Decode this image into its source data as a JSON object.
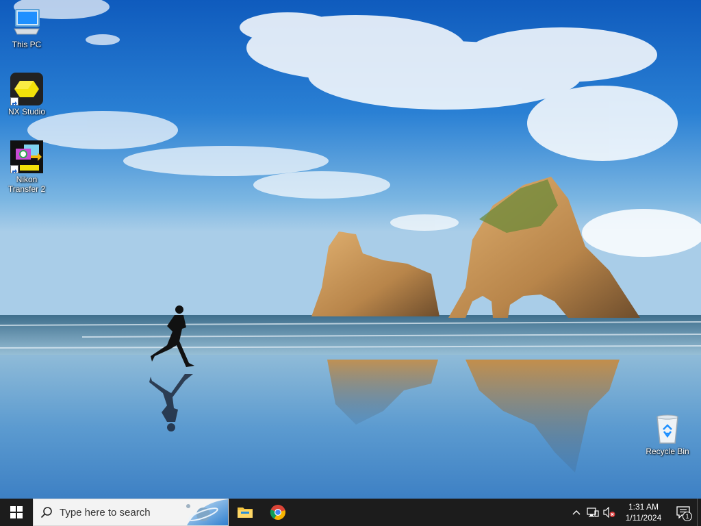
{
  "desktop": {
    "icons": [
      {
        "label": "This PC",
        "icon": "computer-icon"
      },
      {
        "label": "NX Studio",
        "icon": "nx-studio-icon"
      },
      {
        "label": "Nikon Transfer 2",
        "icon": "nikon-transfer-icon"
      },
      {
        "label": "Recycle Bin",
        "icon": "recycle-bin-icon"
      }
    ]
  },
  "taskbar": {
    "search": {
      "placeholder": "Type here to search"
    },
    "pinned": [
      {
        "name": "File Explorer",
        "icon": "folder-icon"
      },
      {
        "name": "Google Chrome",
        "icon": "chrome-icon"
      }
    ],
    "tray": {
      "time": "1:31 AM",
      "date": "1/11/2024",
      "notification_count": "1"
    }
  },
  "colors": {
    "taskbar_bg": "#1c1c1c",
    "search_bg": "#f3f3f3",
    "windows_blue": "#0078d7"
  }
}
